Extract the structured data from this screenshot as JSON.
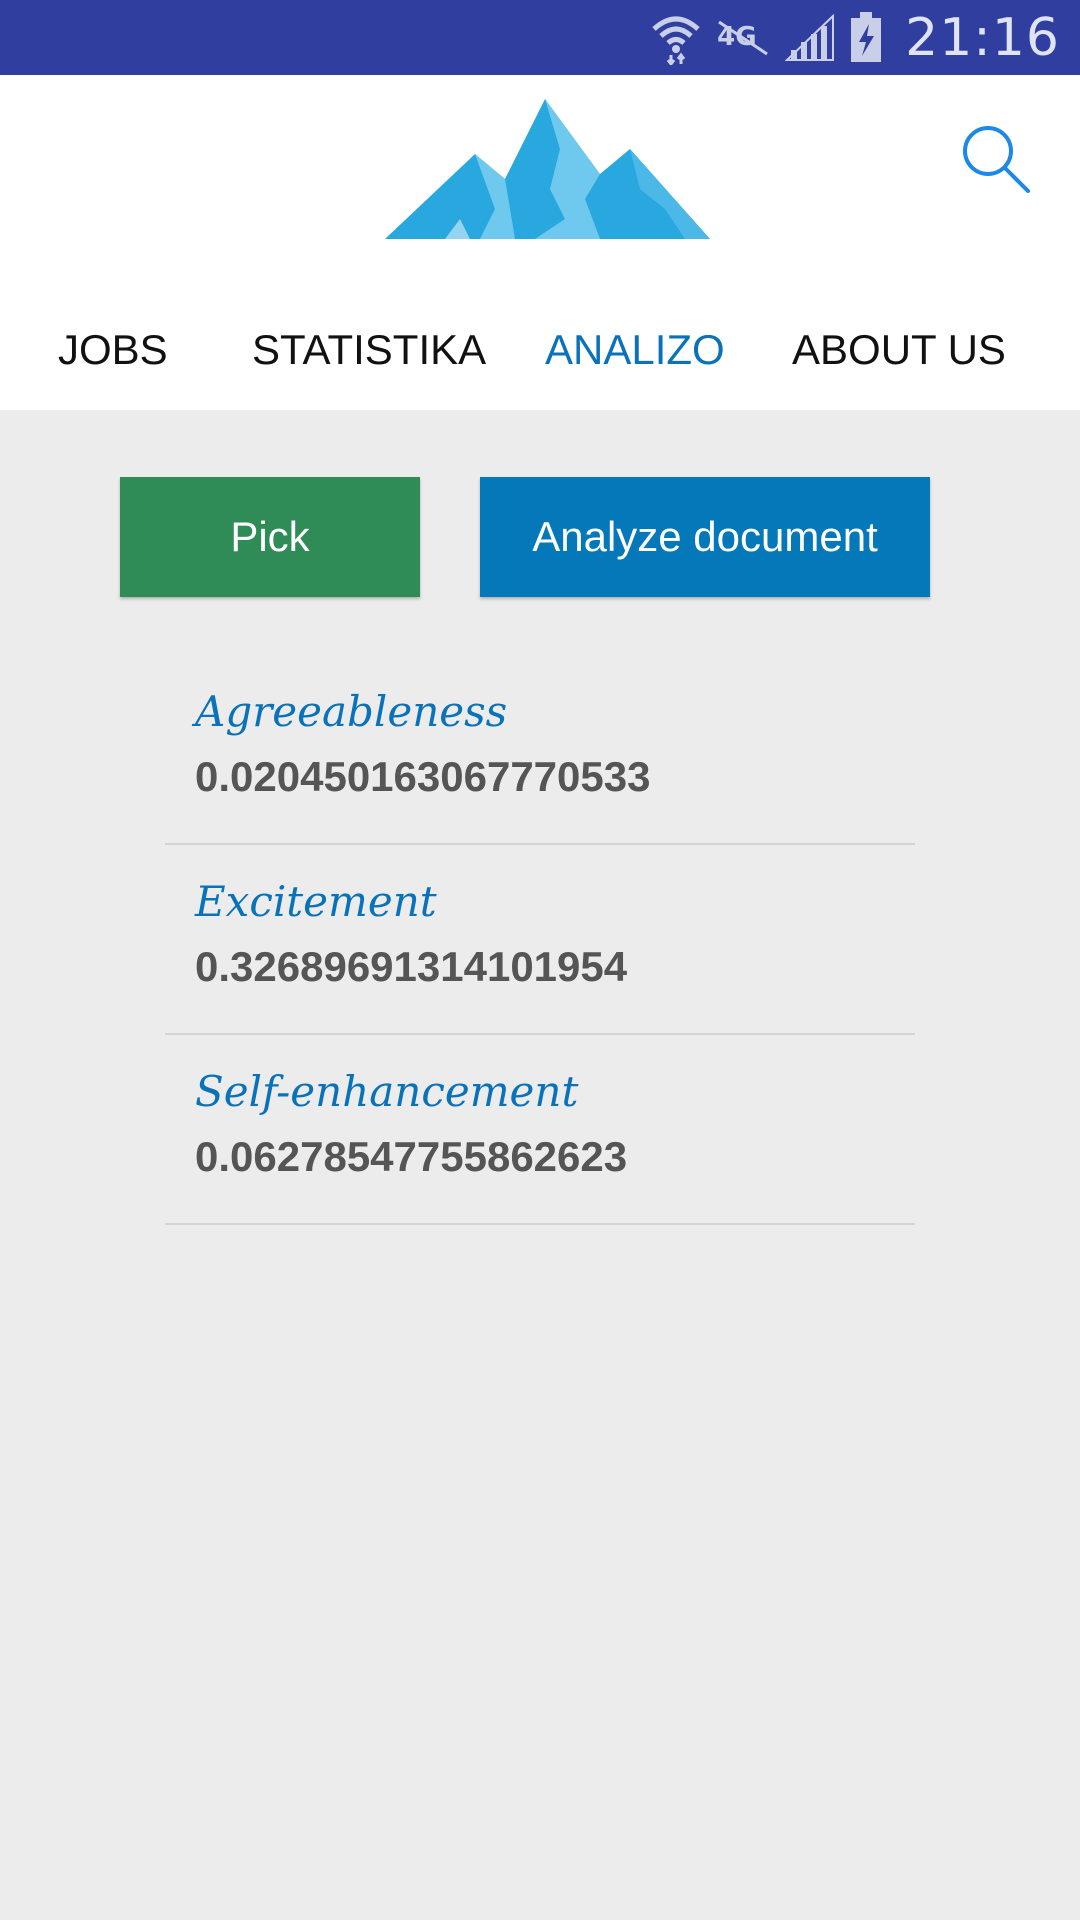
{
  "status_bar": {
    "time": "21:16",
    "network_label": "4G",
    "icons": [
      "wifi-icon",
      "network-4g-icon",
      "signal-icon",
      "battery-charging-icon"
    ]
  },
  "header": {
    "logo": "mountain-logo",
    "search_icon": "search-icon"
  },
  "nav": {
    "tabs": [
      {
        "label": "JOBS",
        "active": false
      },
      {
        "label": "STATISTIKA",
        "active": false
      },
      {
        "label": "ANALIZO",
        "active": true
      },
      {
        "label": "ABOUT US",
        "active": false
      }
    ]
  },
  "actions": {
    "pick_label": "Pick",
    "analyze_label": "Analyze document"
  },
  "results": [
    {
      "label": "Agreeableness",
      "value": "0.020450163067770533"
    },
    {
      "label": "Excitement",
      "value": "0.32689691314101954"
    },
    {
      "label": "Self-enhancement",
      "value": "0.06278547755862623"
    }
  ],
  "colors": {
    "status_bar": "#303f9f",
    "accent": "#0a72b8",
    "pick_button": "#2f8c57",
    "analyze_button": "#0478b9",
    "background": "#ececec"
  }
}
